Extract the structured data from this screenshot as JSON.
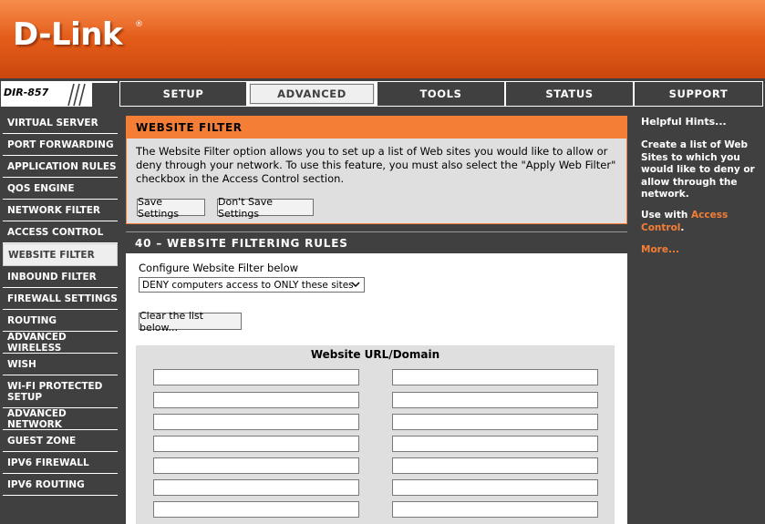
{
  "brand": {
    "logo": "D-Link",
    "registered_mark": "®",
    "model": "DIR-857"
  },
  "nav": {
    "tabs": [
      {
        "label": "SETUP"
      },
      {
        "label": "ADVANCED"
      },
      {
        "label": "TOOLS"
      },
      {
        "label": "STATUS"
      },
      {
        "label": "SUPPORT"
      }
    ],
    "active_tab": "ADVANCED"
  },
  "sidebar": {
    "items": [
      {
        "label": "VIRTUAL SERVER"
      },
      {
        "label": "PORT FORWARDING"
      },
      {
        "label": "APPLICATION RULES"
      },
      {
        "label": "QOS ENGINE"
      },
      {
        "label": "NETWORK FILTER"
      },
      {
        "label": "ACCESS CONTROL"
      },
      {
        "label": "WEBSITE FILTER"
      },
      {
        "label": "INBOUND FILTER"
      },
      {
        "label": "FIREWALL SETTINGS"
      },
      {
        "label": "ROUTING"
      },
      {
        "label": "ADVANCED WIRELESS"
      },
      {
        "label": "WISH"
      },
      {
        "label": "WI-FI PROTECTED SETUP"
      },
      {
        "label": "ADVANCED NETWORK"
      },
      {
        "label": "GUEST ZONE"
      },
      {
        "label": "IPV6 FIREWALL"
      },
      {
        "label": "IPV6 ROUTING"
      }
    ],
    "active": "WEBSITE FILTER"
  },
  "website_filter": {
    "title": "WEBSITE FILTER",
    "description": "The Website Filter option allows you to set up a list of Web sites you would like to allow or deny through your network. To use this feature, you must also select the \"Apply Web Filter\" checkbox in the Access Control section.",
    "save_label": "Save Settings",
    "dont_save_label": "Don't Save Settings"
  },
  "rules": {
    "title": "40 – WEBSITE FILTERING RULES",
    "configure_label": "Configure Website Filter below",
    "select_value": "DENY computers access to ONLY these sites",
    "clear_label": "Clear the list below...",
    "url_header": "Website URL/Domain",
    "url_values": [
      "",
      "",
      "",
      "",
      "",
      "",
      "",
      "",
      "",
      "",
      "",
      "",
      "",
      "",
      "",
      ""
    ]
  },
  "hints": {
    "title": "Helpful Hints...",
    "body": "Create a list of Web Sites to which you would like to deny or allow through the network.",
    "use_with": "Use with",
    "access_link": "Access Control",
    "period": ".",
    "more": "More..."
  },
  "colors": {
    "accent": "#f57e36",
    "dark": "#404040",
    "banner": "#e25a18"
  },
  "icons": {
    "select_arrow": "chevron-down-icon"
  }
}
